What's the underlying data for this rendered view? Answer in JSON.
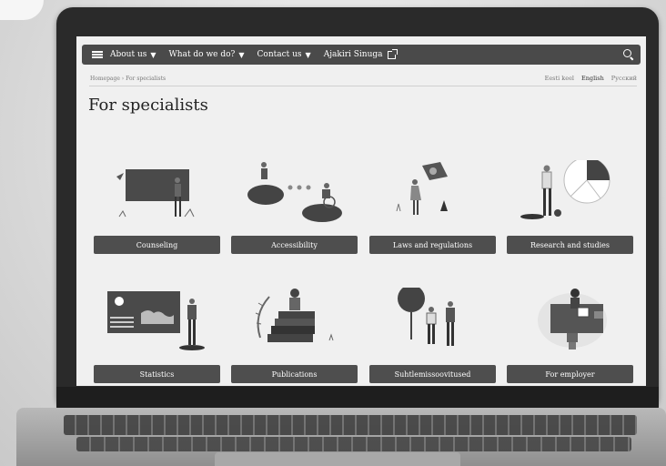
{
  "nav": {
    "items": [
      {
        "label": "About us",
        "caret": "▼"
      },
      {
        "label": "What do we do?",
        "caret": "▼"
      },
      {
        "label": "Contact us",
        "caret": "▼"
      },
      {
        "label": "Ajakiri Sinuga",
        "caret": ""
      }
    ]
  },
  "breadcrumb": "Homepage › For specialists",
  "languages": [
    "Eesti keel",
    "English",
    "Русский"
  ],
  "page_title": "For specialists",
  "cards": [
    {
      "label": "Counseling"
    },
    {
      "label": "Accessibility"
    },
    {
      "label": "Laws and regulations"
    },
    {
      "label": "Research and studies"
    },
    {
      "label": "Statistics"
    },
    {
      "label": "Publications"
    },
    {
      "label": "Suhtlemissoovitused"
    },
    {
      "label": "For employer"
    }
  ],
  "colors": {
    "navbar": "#4a4a4a",
    "button": "#4e4e4e",
    "screen_bg": "#f0f0f0"
  }
}
